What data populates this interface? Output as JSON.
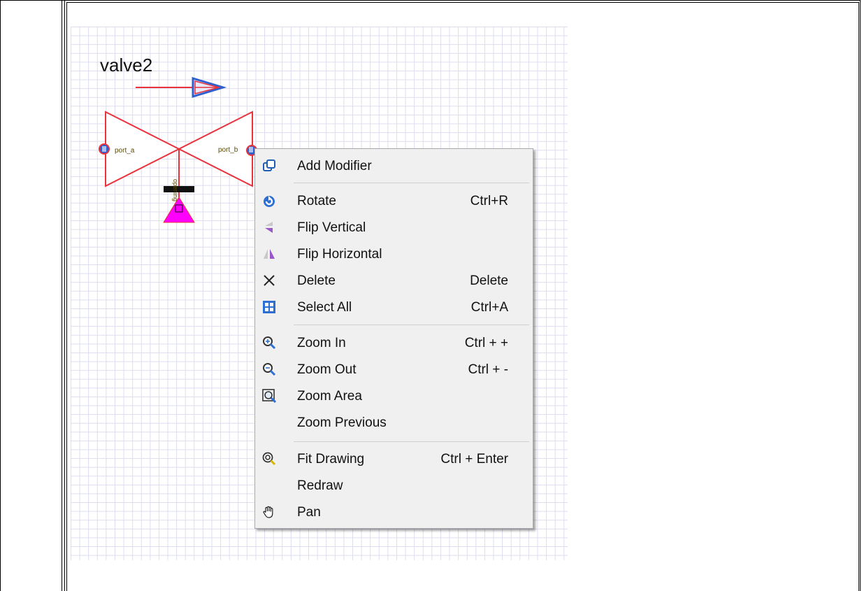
{
  "canvas": {
    "component_name": "valve2",
    "port_a_label": "port_a",
    "port_b_label": "port_b",
    "opening_label": "opening"
  },
  "colors": {
    "valve_stroke": "#e8323c",
    "opening_fill": "#ff00ff",
    "port_blue": "#2e5fcf",
    "menu_bg": "#f0f0f0"
  },
  "context_menu": {
    "items": [
      {
        "label": "Add Modifier",
        "shortcut": "",
        "icon": "add-modifier-icon"
      },
      {
        "label": "Rotate",
        "shortcut": "Ctrl+R",
        "icon": "rotate-icon"
      },
      {
        "label": "Flip Vertical",
        "shortcut": "",
        "icon": "flip-vertical-icon"
      },
      {
        "label": "Flip Horizontal",
        "shortcut": "",
        "icon": "flip-horizontal-icon"
      },
      {
        "label": "Delete",
        "shortcut": "Delete",
        "icon": "delete-icon"
      },
      {
        "label": "Select All",
        "shortcut": "Ctrl+A",
        "icon": "select-all-icon"
      },
      {
        "label": "Zoom In",
        "shortcut": "Ctrl + +",
        "icon": "zoom-in-icon"
      },
      {
        "label": "Zoom Out",
        "shortcut": "Ctrl + -",
        "icon": "zoom-out-icon"
      },
      {
        "label": "Zoom Area",
        "shortcut": "",
        "icon": "zoom-area-icon"
      },
      {
        "label": "Zoom Previous",
        "shortcut": "",
        "icon": ""
      },
      {
        "label": "Fit Drawing",
        "shortcut": "Ctrl + Enter",
        "icon": "fit-drawing-icon"
      },
      {
        "label": "Redraw",
        "shortcut": "",
        "icon": ""
      },
      {
        "label": "Pan",
        "shortcut": "",
        "icon": "pan-hand-icon"
      }
    ]
  }
}
